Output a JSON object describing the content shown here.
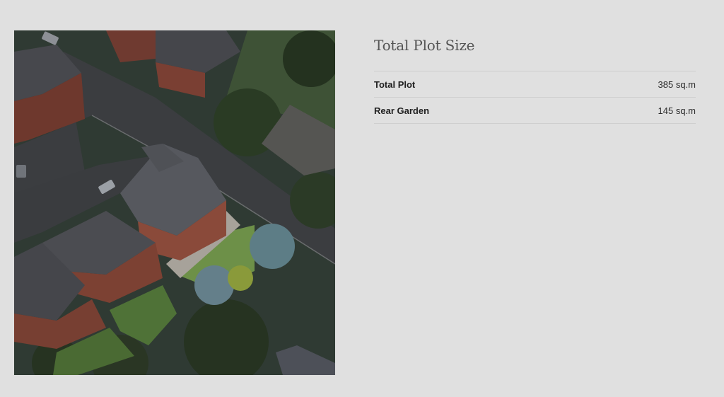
{
  "image": {
    "alt_icon": "aerial-site-plan-image"
  },
  "plot": {
    "title": "Total Plot Size",
    "rows": [
      {
        "label": "Total Plot",
        "value": "385 sq.m"
      },
      {
        "label": "Rear Garden",
        "value": "145 sq.m"
      }
    ]
  }
}
